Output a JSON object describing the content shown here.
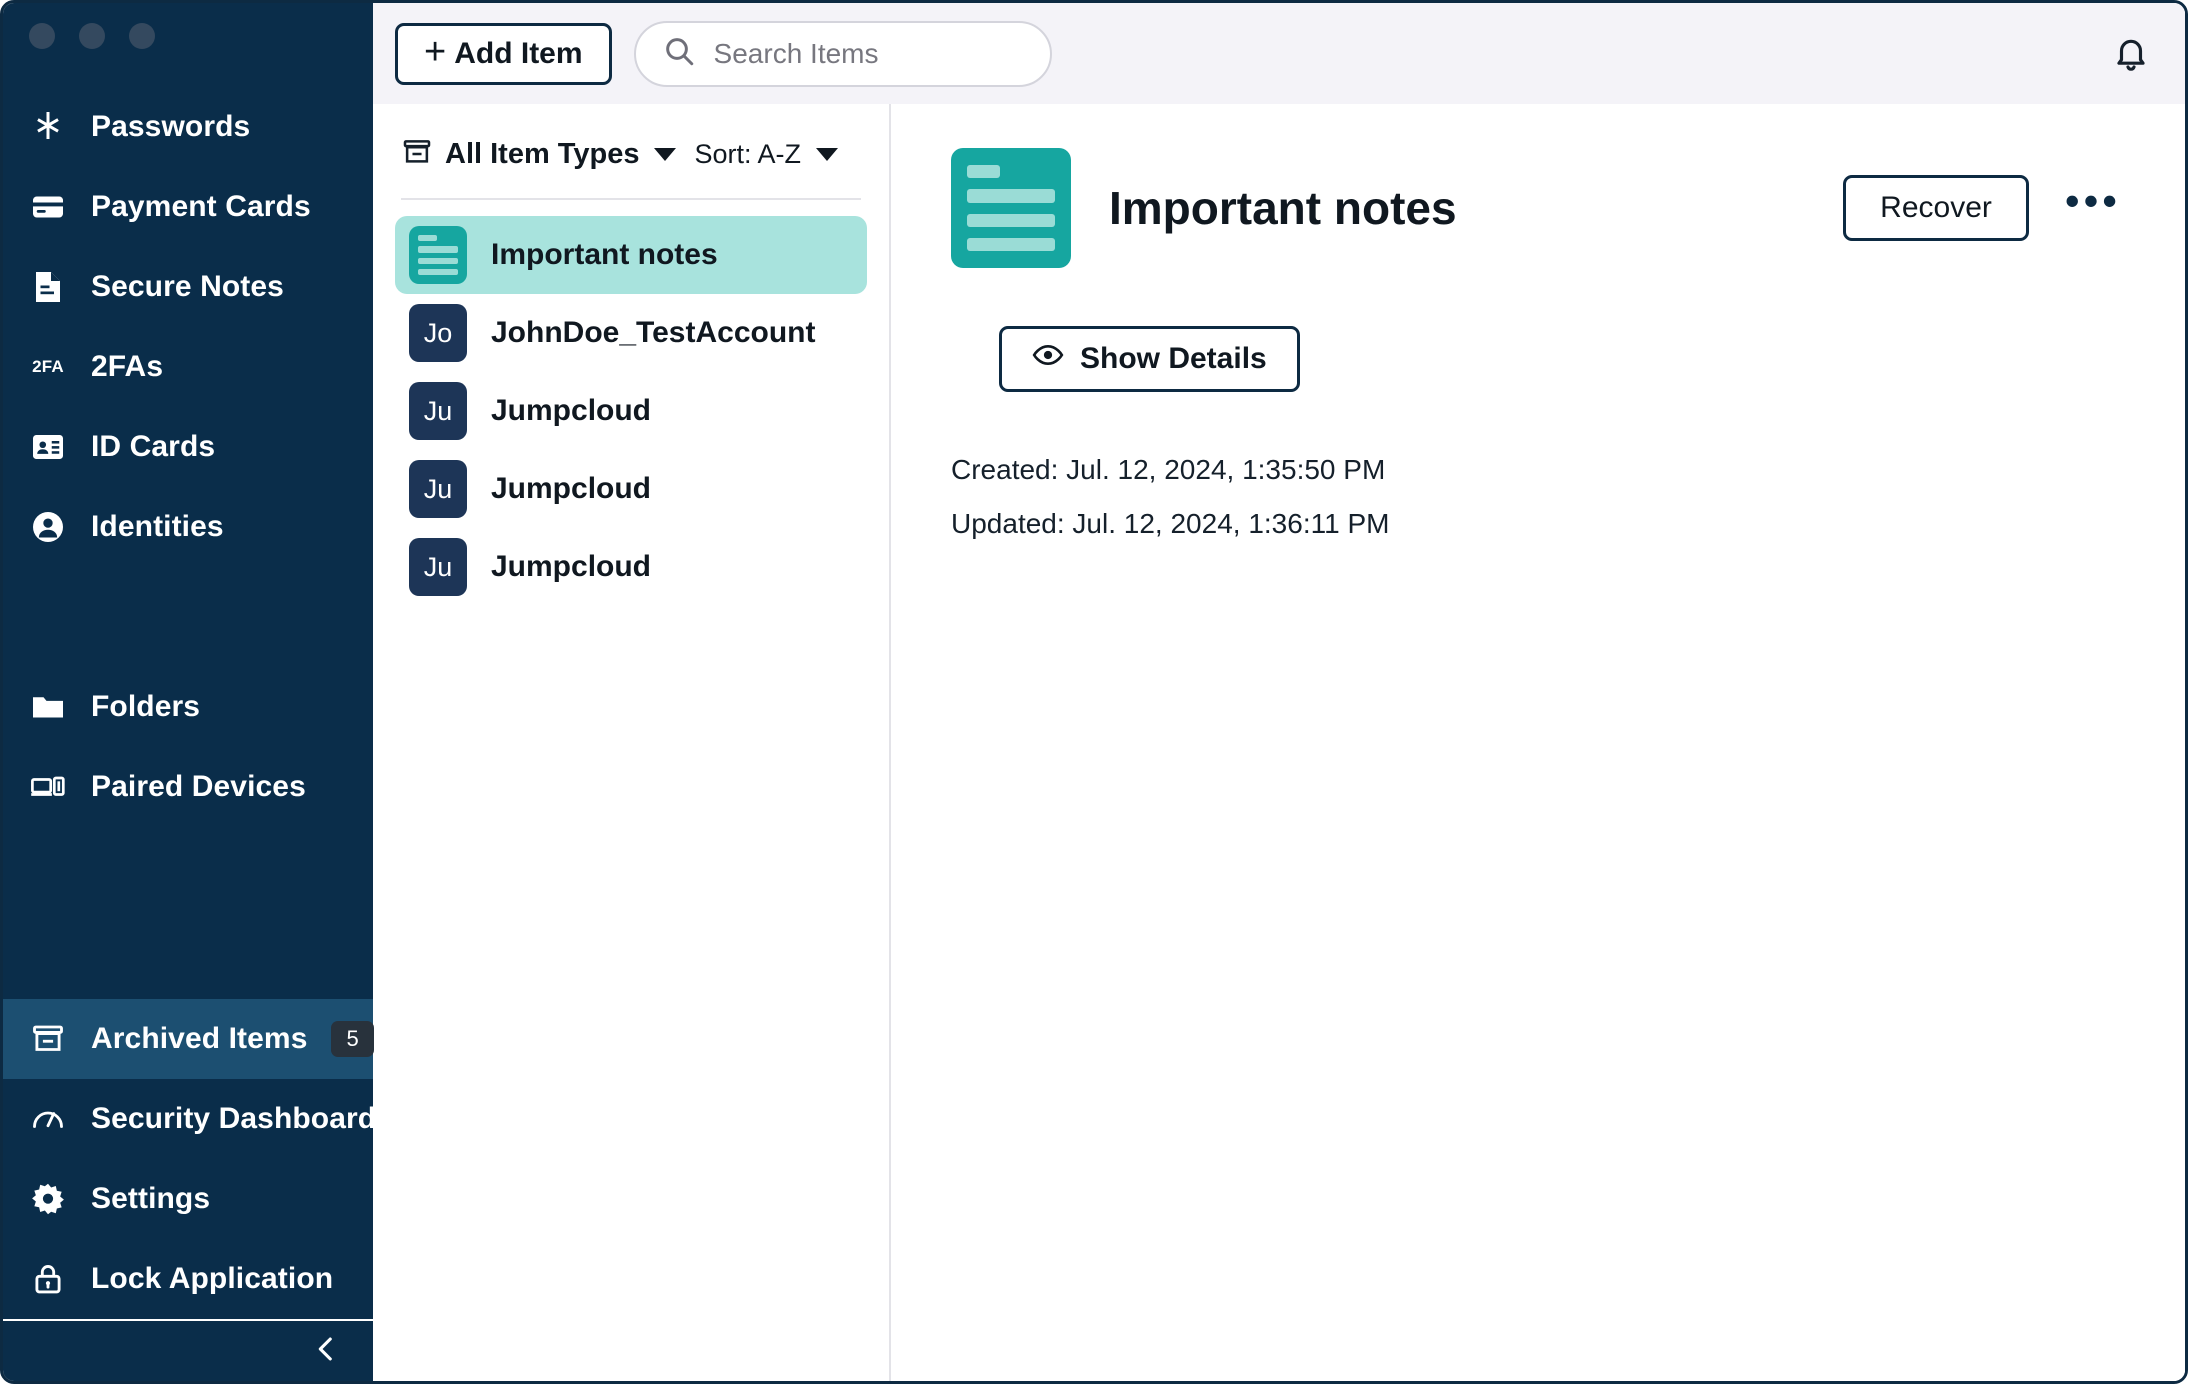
{
  "window": {
    "traffic_lights": [
      "close",
      "minimize",
      "zoom"
    ]
  },
  "sidebar": {
    "items": [
      {
        "label": "Passwords",
        "icon": "asterisk-icon"
      },
      {
        "label": "Payment Cards",
        "icon": "credit-card-icon"
      },
      {
        "label": "Secure Notes",
        "icon": "note-document-icon"
      },
      {
        "label": "2FAs",
        "icon": "2fa-icon"
      },
      {
        "label": "ID Cards",
        "icon": "id-card-icon"
      },
      {
        "label": "Identities",
        "icon": "person-circle-icon"
      },
      {
        "label": "Folders",
        "icon": "folder-icon"
      },
      {
        "label": "Paired Devices",
        "icon": "devices-icon"
      }
    ],
    "bottom_items": [
      {
        "label": "Archived Items",
        "icon": "archive-box-icon",
        "badge": "5",
        "active": true
      },
      {
        "label": "Security Dashboard",
        "icon": "gauge-icon",
        "badge": "",
        "active": false
      },
      {
        "label": "Settings",
        "icon": "gear-icon",
        "badge": "",
        "active": false
      },
      {
        "label": "Lock Application",
        "icon": "lock-icon",
        "badge": "",
        "active": false
      }
    ],
    "collapse_icon": "chevron-left-icon"
  },
  "topbar": {
    "add_item_label": "Add Item",
    "add_item_plus": "+",
    "search_placeholder": "Search Items",
    "search_value": "",
    "search_icon": "search-icon",
    "bell_icon": "bell-icon"
  },
  "list_panel": {
    "type_filter_label": "All Item Types",
    "type_filter_icon": "archive-box-icon",
    "sort_label": "Sort: A-Z",
    "items": [
      {
        "title": "Important notes",
        "kind": "note",
        "initials": "",
        "selected": true
      },
      {
        "title": "JohnDoe_TestAccount",
        "kind": "account",
        "initials": "Jo",
        "selected": false
      },
      {
        "title": "Jumpcloud",
        "kind": "account",
        "initials": "Ju",
        "selected": false
      },
      {
        "title": "Jumpcloud",
        "kind": "account",
        "initials": "Ju",
        "selected": false
      },
      {
        "title": "Jumpcloud",
        "kind": "account",
        "initials": "Ju",
        "selected": false
      }
    ]
  },
  "detail": {
    "title": "Important notes",
    "icon": "note-document-icon",
    "recover_label": "Recover",
    "more_label": "•••",
    "show_details_label": "Show Details",
    "show_details_icon": "eye-icon",
    "created": "Created: Jul. 12, 2024, 1:35:50 PM",
    "updated": "Updated: Jul. 12, 2024, 1:36:11 PM"
  },
  "colors": {
    "sidebar_bg": "#0a2d4a",
    "sidebar_active": "#1c4f71",
    "accent_teal": "#16a6a0",
    "selected_row": "#a8e3dd",
    "avatar_navy": "#1d3557",
    "ink": "#101820",
    "outline": "#0d2a42",
    "topbar_bg": "#f4f3f8"
  }
}
